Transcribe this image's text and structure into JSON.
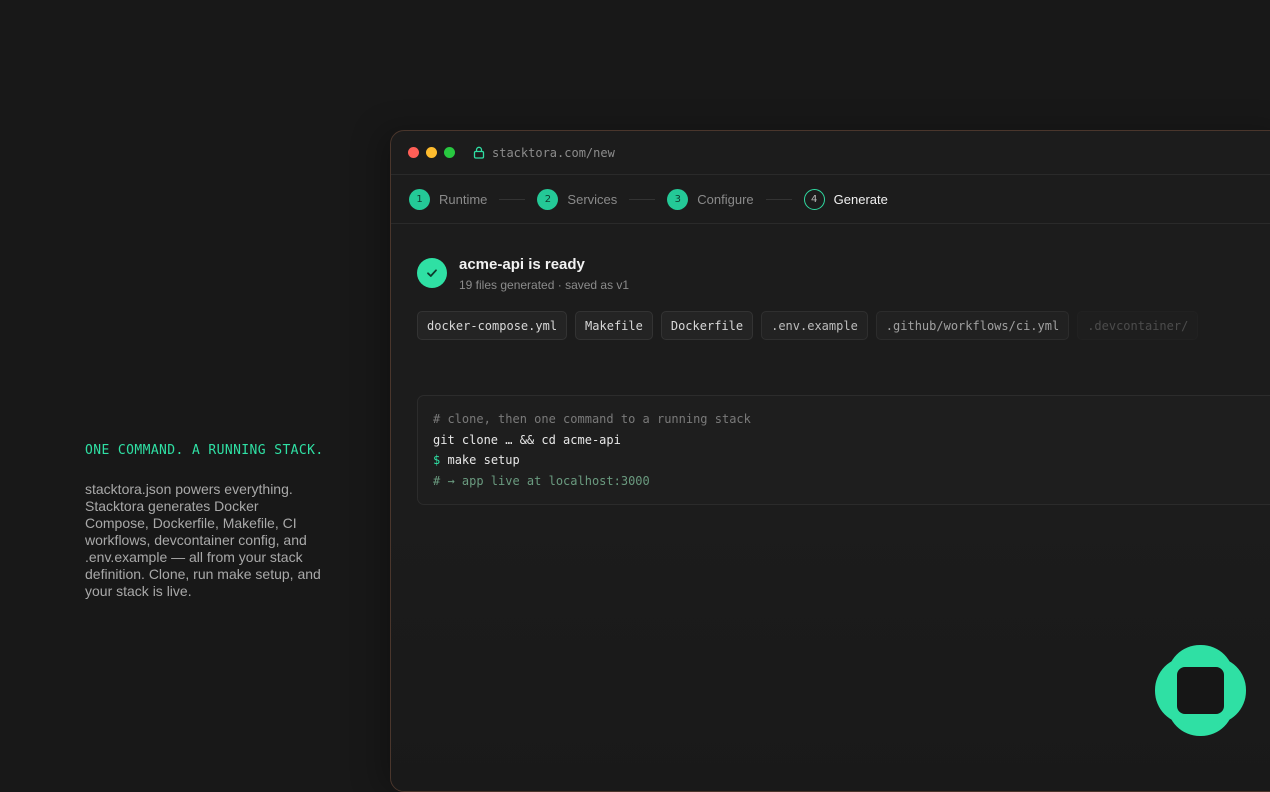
{
  "hero": {
    "tagline": "ONE COMMAND. A RUNNING STACK.",
    "description": "stacktora.json powers everything. Stacktora generates Docker Compose, Dockerfile, Makefile, CI workflows, devcontainer config, and .env.example — all from your stack definition. Clone, run make setup, and your stack is live."
  },
  "browser": {
    "url": "stacktora.com/new"
  },
  "steps": [
    {
      "num": "1",
      "label": "Runtime"
    },
    {
      "num": "2",
      "label": "Services"
    },
    {
      "num": "3",
      "label": "Configure"
    },
    {
      "num": "4",
      "label": "Generate"
    }
  ],
  "result": {
    "title": "acme-api is ready",
    "subtitle": "19 files generated · saved as v1"
  },
  "files": [
    "docker-compose.yml",
    "Makefile",
    "Dockerfile",
    ".env.example",
    ".github/workflows/ci.yml",
    ".devcontainer/"
  ],
  "terminal": {
    "line1": "# clone, then one command to a running stack",
    "line2": "git clone … && cd acme-api",
    "prompt": "$",
    "line3": "make setup",
    "line4": "# → app live at localhost:3000"
  },
  "colors": {
    "accent": "#2fe0a4",
    "background": "#181818",
    "window_border": "#4a362c"
  },
  "icons": {
    "lock": "lock-icon",
    "check": "check-icon",
    "logo": "stacktora-logo"
  }
}
